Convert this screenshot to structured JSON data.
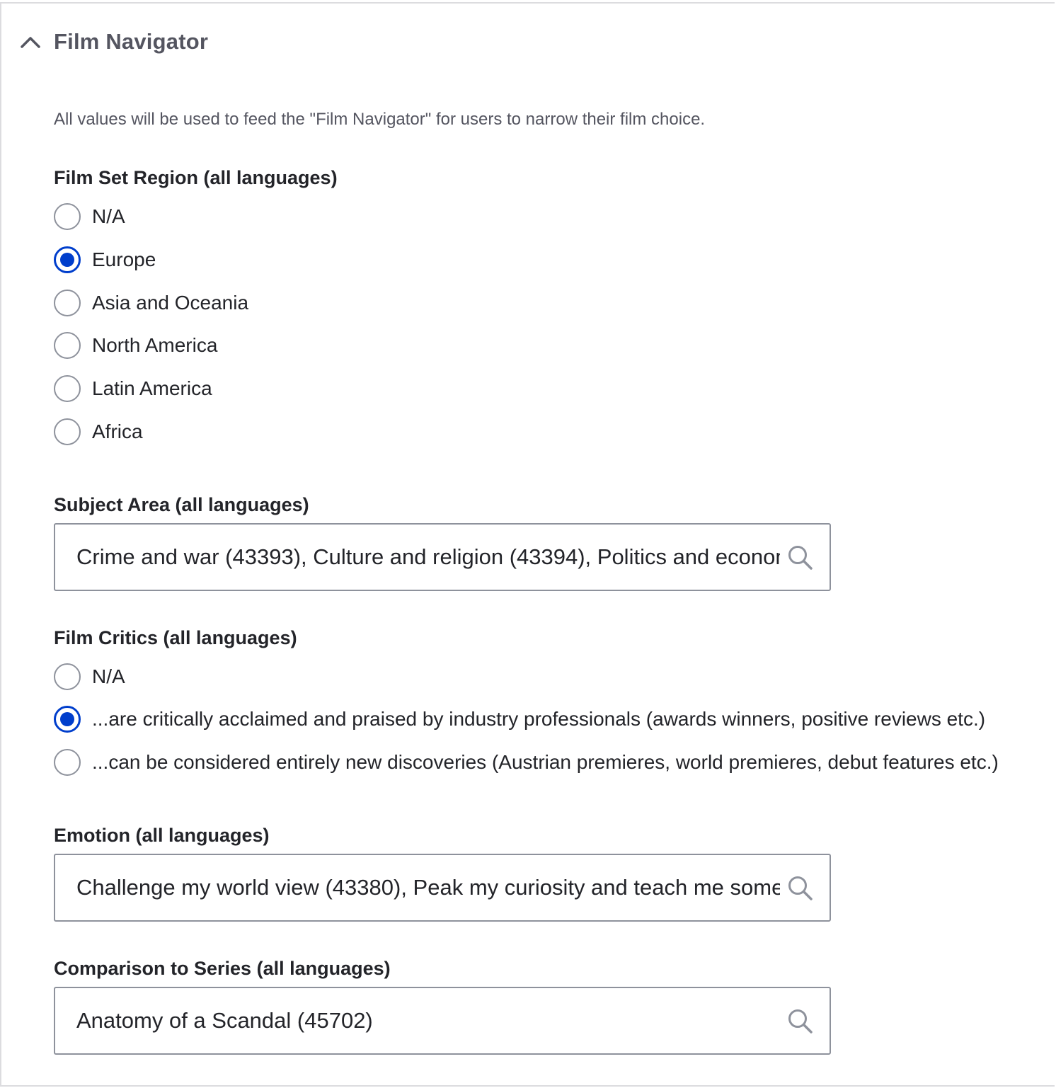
{
  "details": {
    "title": "Film Navigator",
    "expanded": true,
    "description": "All values will be used to feed the \"Film Navigator\" for users to narrow their film choice."
  },
  "film_set_region": {
    "label": "Film Set Region (all languages)",
    "options": [
      "N/A",
      "Europe",
      "Asia and Oceania",
      "North America",
      "Latin America",
      "Africa"
    ],
    "selected": "Europe"
  },
  "subject_area": {
    "label": "Subject Area (all languages)",
    "value": "Crime and war (43393), Culture and religion (43394), Politics and economy"
  },
  "film_critics": {
    "label": "Film Critics (all languages)",
    "options": [
      "N/A",
      "...are critically acclaimed and praised by industry professionals (awards winners, positive reviews etc.)",
      "...can be considered entirely new discoveries (Austrian premieres, world premieres, debut features etc.)"
    ],
    "selected": "...are critically acclaimed and praised by industry professionals (awards winners, positive reviews etc.)"
  },
  "emotion": {
    "label": "Emotion (all languages)",
    "value": "Challenge my world view (43380), Peak my curiosity and teach me something"
  },
  "comparison_to_series": {
    "label": "Comparison to Series (all languages)",
    "value": "Anatomy of a Scandal (45702)"
  },
  "icons": {
    "toggle": "chevron-up-icon",
    "search": "search-icon"
  },
  "colors": {
    "accent": "#003ecc",
    "text": "#232429",
    "muted_text": "#545560",
    "border": "#8e929c"
  }
}
